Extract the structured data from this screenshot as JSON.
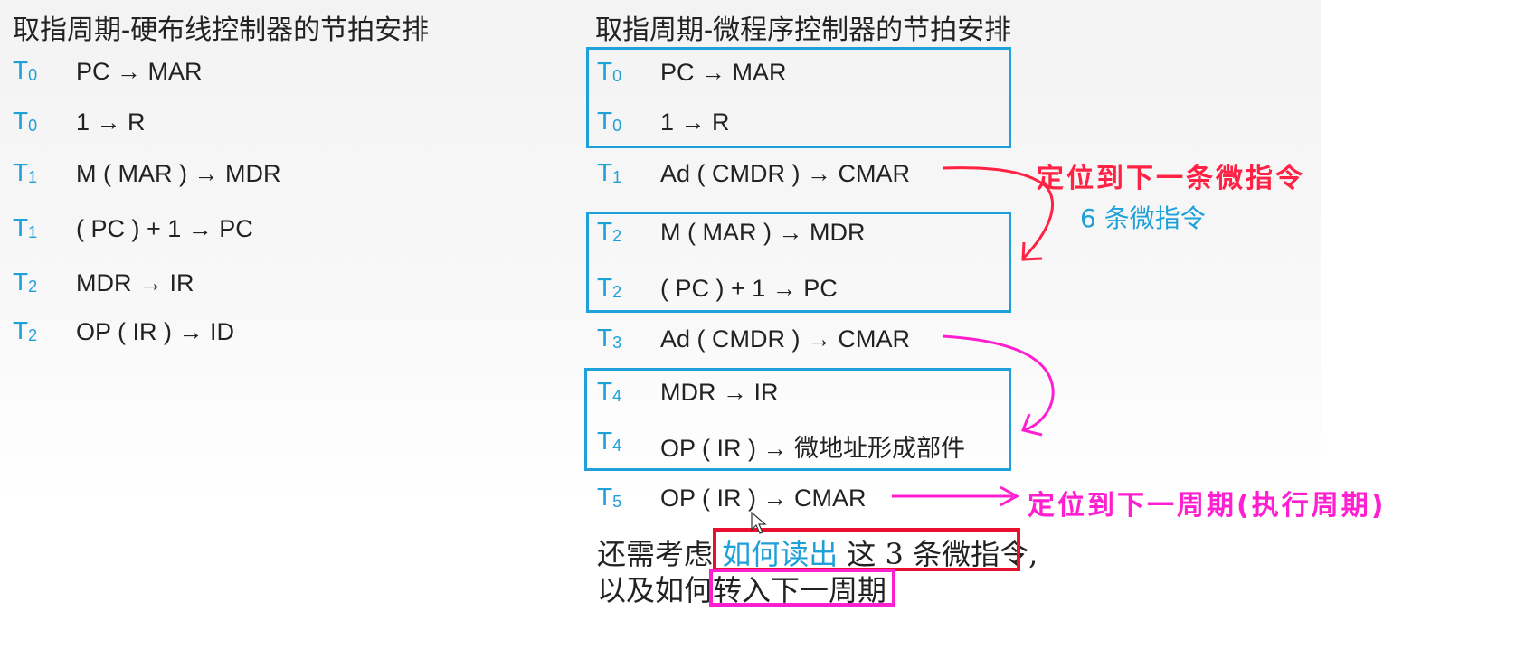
{
  "left": {
    "heading": "取指周期-硬布线控制器的节拍安排",
    "rows": [
      {
        "t": "T",
        "sub": "0",
        "op": "PC → MAR"
      },
      {
        "t": "T",
        "sub": "0",
        "op": "1 → R"
      },
      {
        "t": "T",
        "sub": "1",
        "op": "M ( MAR ) → MDR"
      },
      {
        "t": "T",
        "sub": "1",
        "op": "( PC ) + 1 → PC"
      },
      {
        "t": "T",
        "sub": "2",
        "op": "MDR → IR"
      },
      {
        "t": "T",
        "sub": "2",
        "op": "OP ( IR ) → ID"
      }
    ]
  },
  "right": {
    "heading": "取指周期-微程序控制器的节拍安排",
    "rows": [
      {
        "t": "T",
        "sub": "0",
        "op": "PC → MAR"
      },
      {
        "t": "T",
        "sub": "0",
        "op": "1 → R"
      },
      {
        "t": "T",
        "sub": "1",
        "op": "Ad ( CMDR ) → CMAR"
      },
      {
        "t": "T",
        "sub": "2",
        "op": "M ( MAR ) → MDR"
      },
      {
        "t": "T",
        "sub": "2",
        "op": "( PC ) + 1 → PC"
      },
      {
        "t": "T",
        "sub": "3",
        "op": "Ad ( CMDR ) → CMAR"
      },
      {
        "t": "T",
        "sub": "4",
        "op": "MDR → IR"
      },
      {
        "t": "T",
        "sub": "4",
        "op": "OP ( IR ) → 微地址形成部件"
      },
      {
        "t": "T",
        "sub": "5",
        "op": "OP ( IR ) → CMAR"
      }
    ]
  },
  "annotations": {
    "next_micro": "定位到下一条微指令",
    "six_micro": "6 条微指令",
    "next_cycle": "定位到下一周期(执行周期)",
    "colors": {
      "blue": "#1ea0d8",
      "red": "#ff2244",
      "magenta": "#ff1fd0"
    }
  },
  "bottom": {
    "line1_a": "还需考虑",
    "line1_hl": "如何读出",
    "line1_b": "这 3 条微指令,",
    "line2_a": "以及如何",
    "line2_hl": "转入下一周期"
  }
}
